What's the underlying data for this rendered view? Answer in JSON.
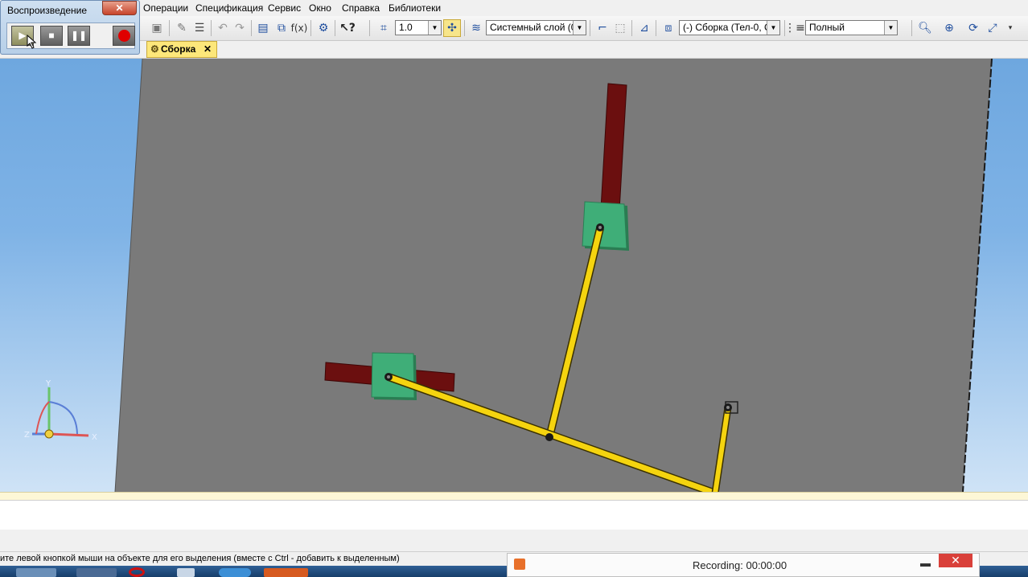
{
  "menu": {
    "items": [
      {
        "label": "Операции"
      },
      {
        "label": "Спецификация"
      },
      {
        "label": "Сервис"
      },
      {
        "label": "Окно"
      },
      {
        "label": "Справка"
      },
      {
        "label": "Библиотеки"
      }
    ]
  },
  "toolbar": {
    "scale_value": "1.0",
    "layer_value": "Системный слой (0)",
    "assembly_value": "(-) Сборка (Тел-0, С",
    "view_mode_value": "Полный",
    "fx_label": "f(x)"
  },
  "tabs": {
    "active_label": "Сборка",
    "close_glyph": "✕"
  },
  "playback": {
    "title": "Воспроизведение",
    "close_glyph": "✕",
    "record_color": "#e00000"
  },
  "axes": {
    "x_label": "X",
    "y_label": "Y",
    "z_label": "Z"
  },
  "status": {
    "hint": "ите левой кнопкой мыши на объекте для его выделения (вместе с Ctrl - добавить к выделенным)"
  },
  "recording": {
    "label": "Recording: 00:00:00",
    "close_glyph": "✕",
    "minimize_glyph": "▬"
  },
  "colors": {
    "sheet": "#7a7a7a",
    "rod": "#f5d40f",
    "slider_block": "#3fae78",
    "guide_bar": "#6b0f0f",
    "sky_top": "#6ea7df"
  }
}
